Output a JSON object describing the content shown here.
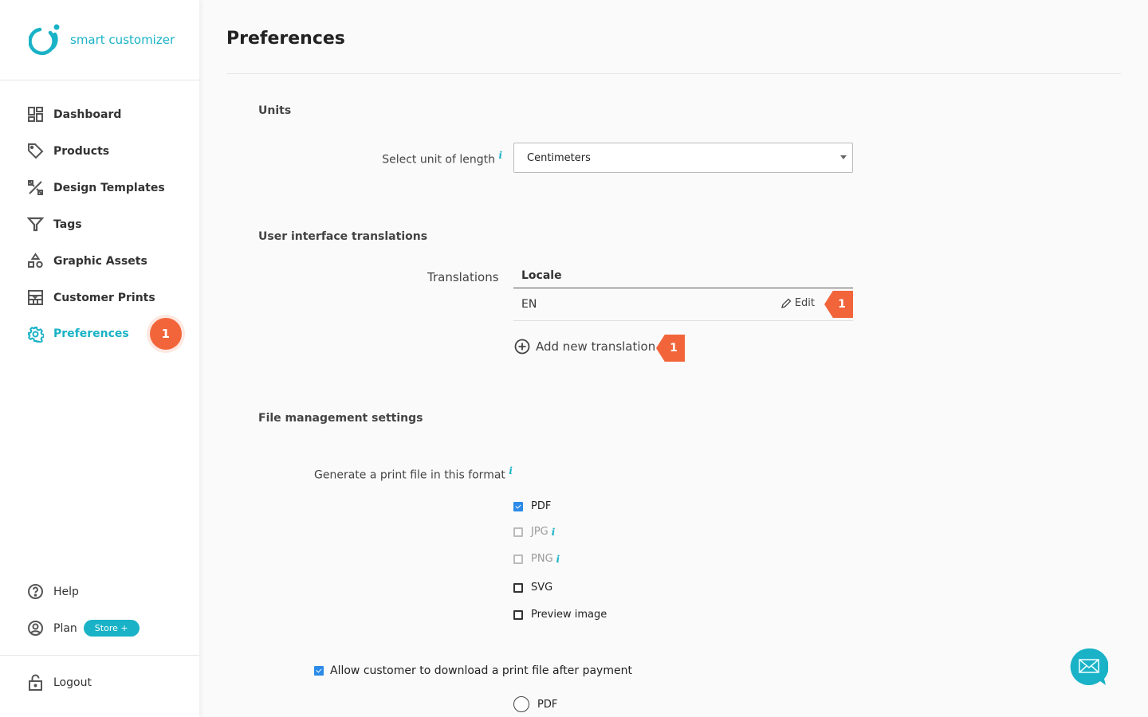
{
  "brand": {
    "name": "smart customizer",
    "accent": "#19b2c6",
    "badge_color": "#f2653a"
  },
  "sidebar": {
    "items": [
      {
        "label": "Dashboard",
        "icon": "dashboard-icon"
      },
      {
        "label": "Products",
        "icon": "tag-icon"
      },
      {
        "label": "Design Templates",
        "icon": "design-tools-icon"
      },
      {
        "label": "Tags",
        "icon": "filter-icon"
      },
      {
        "label": "Graphic Assets",
        "icon": "shapes-icon"
      },
      {
        "label": "Customer Prints",
        "icon": "prints-icon"
      },
      {
        "label": "Preferences",
        "icon": "gear-icon",
        "active": true,
        "badge": "1"
      }
    ],
    "help": "Help",
    "plan": "Plan",
    "plan_badge": "Store +",
    "logout": "Logout"
  },
  "page": {
    "title": "Preferences"
  },
  "units": {
    "heading": "Units",
    "label": "Select unit of length",
    "value": "Centimeters"
  },
  "translations": {
    "heading": "User interface translations",
    "label": "Translations",
    "column": "Locale",
    "rows": [
      {
        "locale": "EN",
        "action": "Edit",
        "badge": "1"
      }
    ],
    "add_label": "Add new translation",
    "add_badge": "1"
  },
  "files": {
    "heading": "File management settings",
    "format_label": "Generate a print file in this format",
    "formats": [
      {
        "label": "PDF",
        "checked": true,
        "disabled": false
      },
      {
        "label": "JPG",
        "checked": false,
        "disabled": true,
        "info": true
      },
      {
        "label": "PNG",
        "checked": false,
        "disabled": true,
        "info": true
      },
      {
        "label": "SVG",
        "checked": false,
        "disabled": false
      },
      {
        "label": "Preview image",
        "checked": false,
        "disabled": false
      }
    ],
    "allow_download": {
      "label": "Allow customer to download a print file after payment",
      "checked": true
    },
    "download_formats": [
      {
        "label": "PDF",
        "selected": false
      }
    ]
  },
  "info_glyph": "i"
}
